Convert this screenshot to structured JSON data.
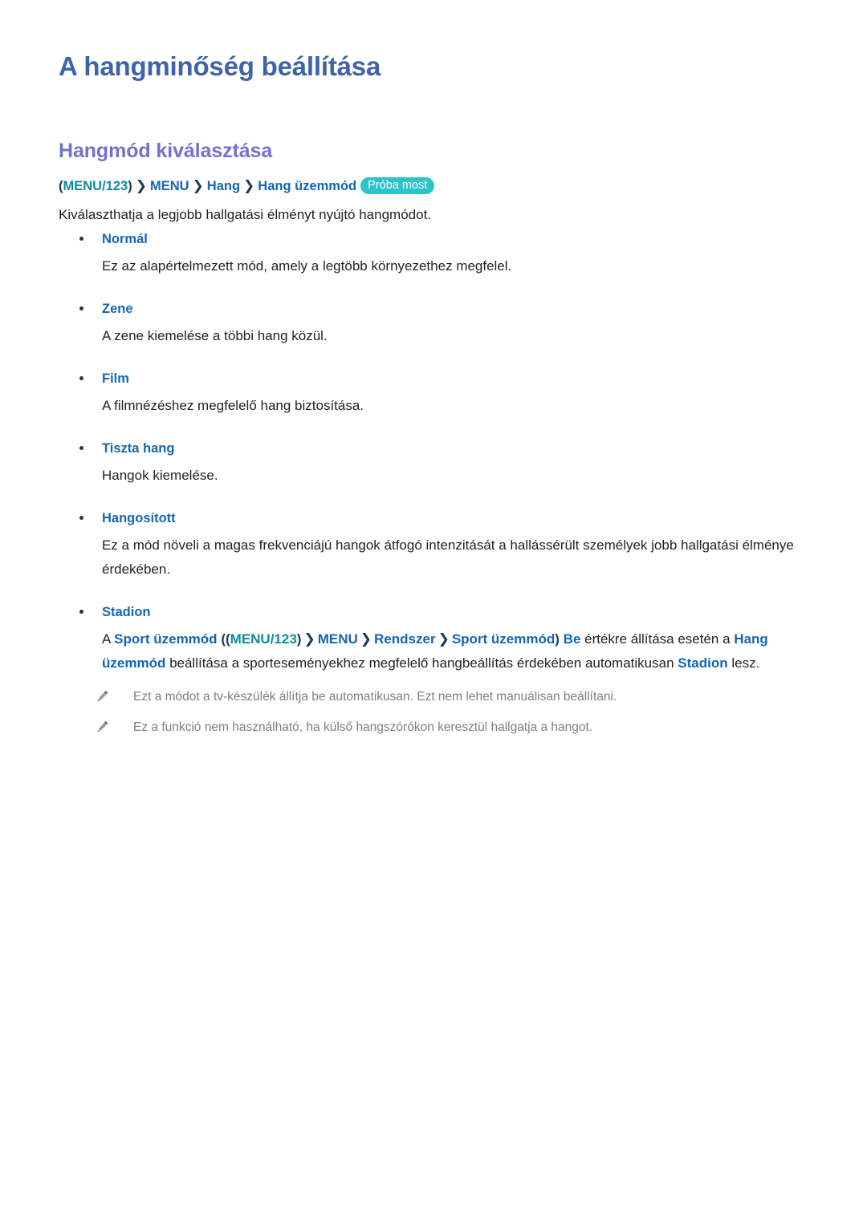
{
  "document": {
    "title": "A hangminőség beállítása",
    "section_title": "Hangmód kiválasztása"
  },
  "breadcrumb": {
    "open_paren": "(",
    "menu123": "MENU/123",
    "close_paren": ")",
    "separator": "❯",
    "menu": "MENU",
    "hang": "Hang",
    "hang_uzemmod": "Hang üzemmód",
    "try_badge": "Próba most"
  },
  "intro": "Kiválaszthatja a legjobb hallgatási élményt nyújtó hangmódot.",
  "modes": [
    {
      "label": "Normál",
      "description": "Ez az alapértelmezett mód, amely a legtöbb környezethez megfelel."
    },
    {
      "label": "Zene",
      "description": "A zene kiemelése a többi hang közül."
    },
    {
      "label": "Film",
      "description": "A filmnézéshez megfelelő hang biztosítása."
    },
    {
      "label": "Tiszta hang",
      "description": "Hangok kiemelése."
    },
    {
      "label": "Hangosított",
      "description": "Ez a mód növeli a magas frekvenciájú hangok átfogó intenzitását a hallássérült személyek jobb hallgatási élménye érdekében."
    },
    {
      "label": "Stadion",
      "description": ""
    }
  ],
  "stadion_note": {
    "part1": "A ",
    "sport_mode_1": "Sport üzemmód",
    "part2": " (",
    "open_paren": "(",
    "menu123": "MENU/123",
    "close_paren": ")",
    "separator": "❯",
    "menu": "MENU",
    "rendszer": "Rendszer",
    "sport_mode_2": "Sport üzemmód",
    "close_paren2": ")",
    "be": "Be",
    "part3": " értékre állítása esetén a ",
    "hang_uzemmod": "Hang üzemmód",
    "part4": " beállítása a sporteseményekhez megfelelő hangbeállítás érdekében automatikusan ",
    "stadion": "Stadion",
    "part5": " lesz."
  },
  "notes": [
    {
      "icon": "pencil-icon",
      "text": "Ezt a módot a tv-készülék állítja be automatikusan. Ezt nem lehet manuálisan beállítani."
    },
    {
      "icon": "pencil-icon",
      "text": "Ez a funkció nem használható, ha külső hangszórókon keresztül hallgatja a hangot."
    }
  ],
  "colors": {
    "title_blue": "#3f63ab",
    "section_purple": "#7272cb",
    "link_blue": "#1266b5",
    "teal": "#0e8b9e",
    "badge_teal": "#2cc3c9",
    "dark_navy": "#1b3b57",
    "body_text": "#231f20",
    "note_gray": "#7f7f7f"
  }
}
